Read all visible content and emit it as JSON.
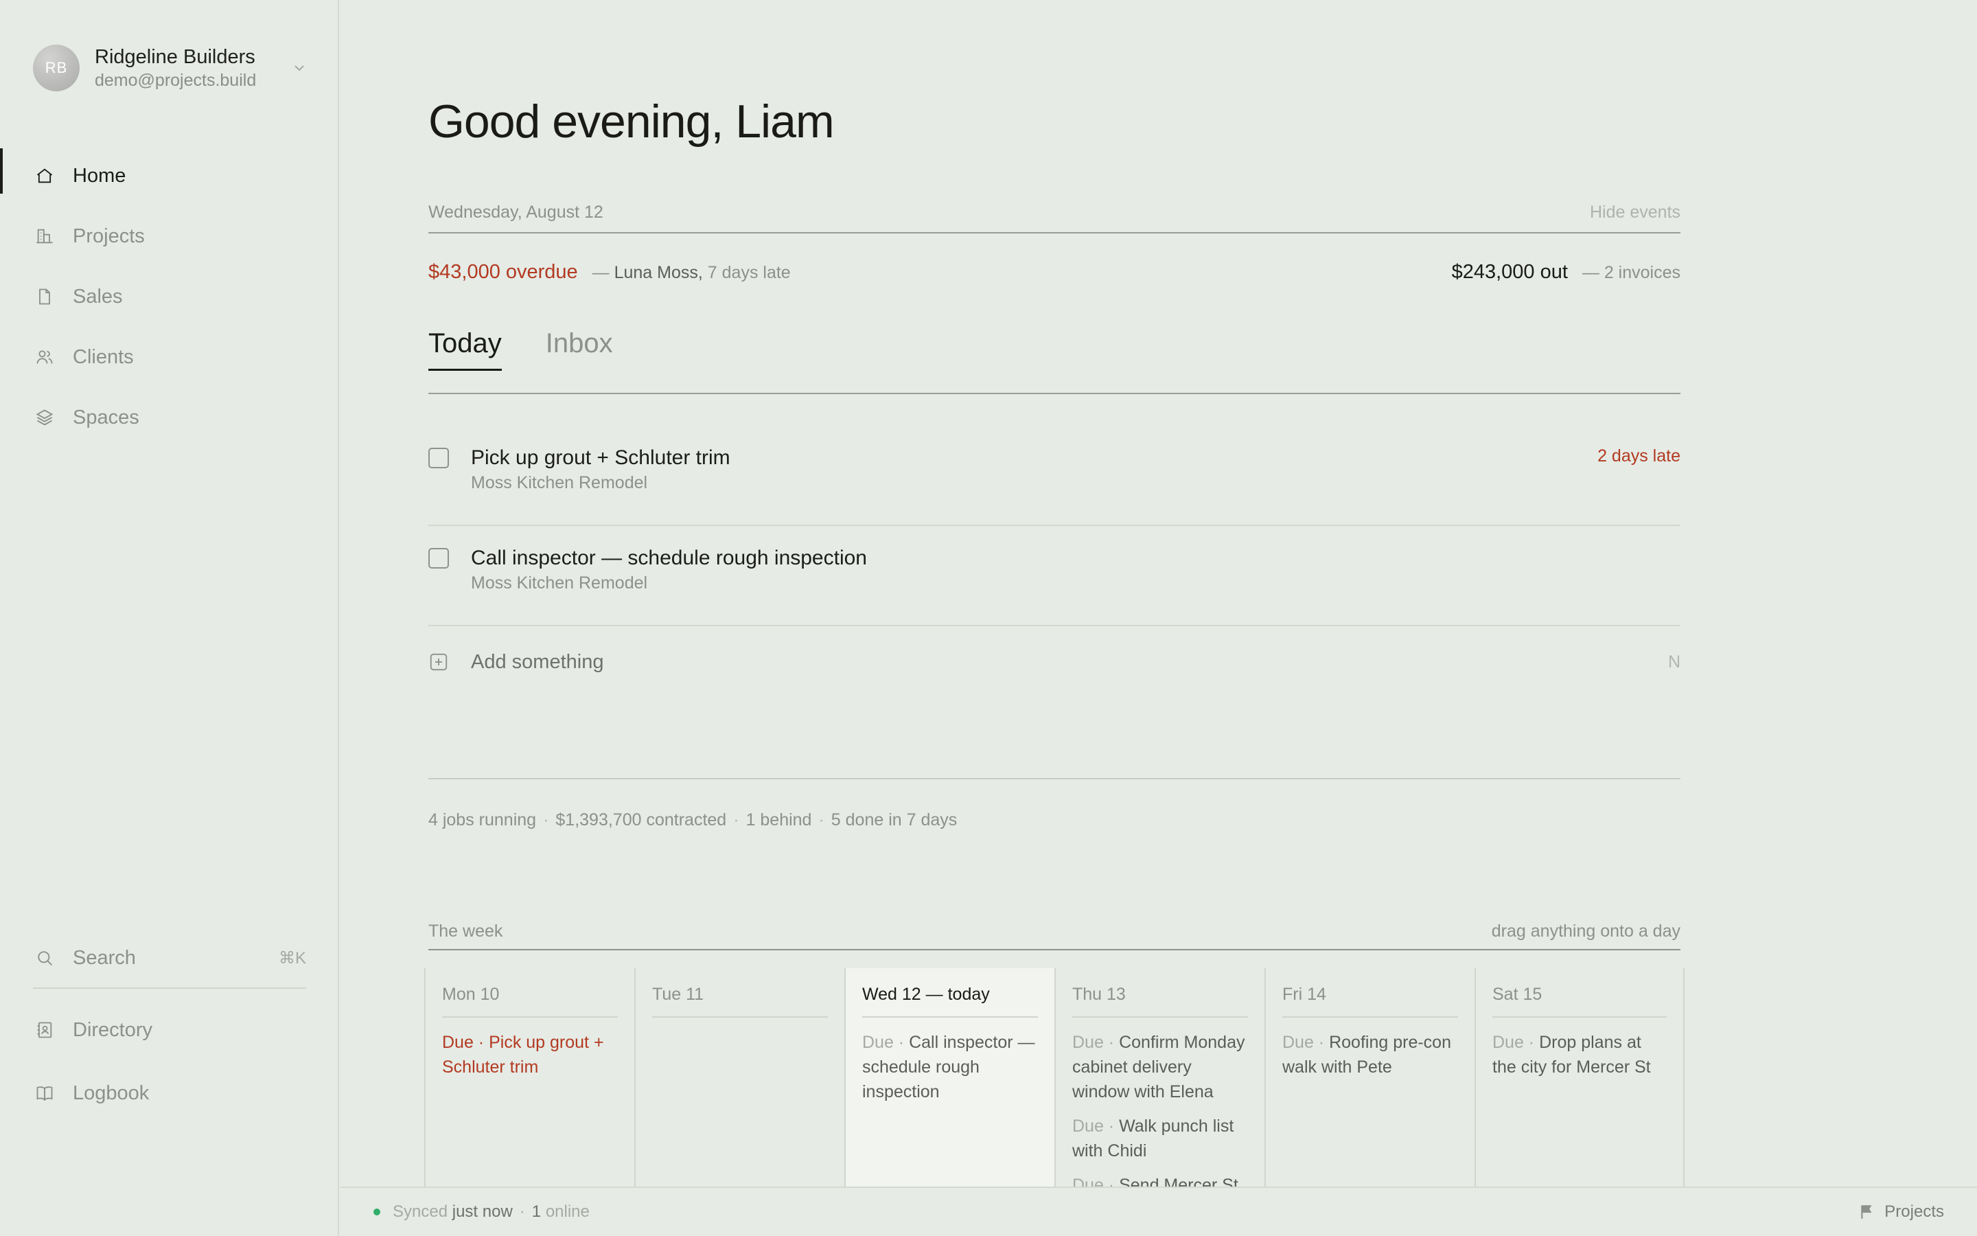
{
  "account": {
    "initials": "RB",
    "name": "Ridgeline Builders",
    "email": "demo@projects.build"
  },
  "nav": {
    "items": [
      {
        "label": "Home",
        "icon": "home-icon",
        "active": true
      },
      {
        "label": "Projects",
        "icon": "buildings-icon",
        "active": false
      },
      {
        "label": "Sales",
        "icon": "document-icon",
        "active": false
      },
      {
        "label": "Clients",
        "icon": "people-icon",
        "active": false
      },
      {
        "label": "Spaces",
        "icon": "layers-icon",
        "active": false
      }
    ],
    "search_label": "Search",
    "search_shortcut": "⌘K",
    "directory_label": "Directory",
    "logbook_label": "Logbook"
  },
  "greeting": "Good evening, Liam",
  "date": "Wednesday, August 12",
  "hide_events": "Hide events",
  "money": {
    "overdue_amount": "$43,000 overdue",
    "overdue_dash": "—",
    "overdue_client": "Luna Moss,",
    "overdue_late": "7 days late",
    "out_amount": "$243,000 out",
    "out_detail": "— 2 invoices"
  },
  "tabs": [
    {
      "label": "Today",
      "active": true
    },
    {
      "label": "Inbox",
      "active": false
    }
  ],
  "tasks": [
    {
      "title": "Pick up grout + Schluter trim",
      "project": "Moss Kitchen Remodel",
      "late": "2 days late"
    },
    {
      "title": "Call inspector — schedule rough inspection",
      "project": "Moss Kitchen Remodel",
      "late": ""
    }
  ],
  "add": {
    "label": "Add something",
    "shortcut": "N"
  },
  "stats": {
    "jobs": "4 jobs running",
    "contracted": "$1,393,700 contracted",
    "behind": "1 behind",
    "done": "5 done in 7 days"
  },
  "week": {
    "title": "The week",
    "hint": "drag anything onto a day",
    "days": [
      {
        "name": "Mon 10",
        "today": false,
        "events": [
          {
            "due": "Due ·",
            "text": "Pick up grout + Schluter trim",
            "late": true
          }
        ]
      },
      {
        "name": "Tue 11",
        "today": false,
        "events": []
      },
      {
        "name": "Wed 12 — today",
        "today": true,
        "events": [
          {
            "due": "Due ·",
            "text": "Call inspector — schedule rough inspection",
            "late": false
          }
        ]
      },
      {
        "name": "Thu 13",
        "today": false,
        "events": [
          {
            "due": "Due ·",
            "text": "Confirm Monday cabinet delivery window with Elena",
            "late": false
          },
          {
            "due": "Due ·",
            "text": "Walk punch list with Chidi",
            "late": false
          },
          {
            "due": "Due ·",
            "text": "Send Mercer St",
            "late": false
          }
        ]
      },
      {
        "name": "Fri 14",
        "today": false,
        "events": [
          {
            "due": "Due ·",
            "text": "Roofing pre-con walk with Pete",
            "late": false
          }
        ]
      },
      {
        "name": "Sat 15",
        "today": false,
        "events": [
          {
            "due": "Due ·",
            "text": "Drop plans at the city for Mercer St",
            "late": false
          }
        ]
      }
    ]
  },
  "status": {
    "synced": "Synced",
    "synced_when": "just now",
    "online_count": "1",
    "online_label": "online",
    "right_label": "Projects"
  },
  "colors": {
    "background": "#e6ebe5",
    "accent_red": "#b33a22",
    "today_column": "#f1f4ef",
    "online_green": "#2fae6a"
  }
}
